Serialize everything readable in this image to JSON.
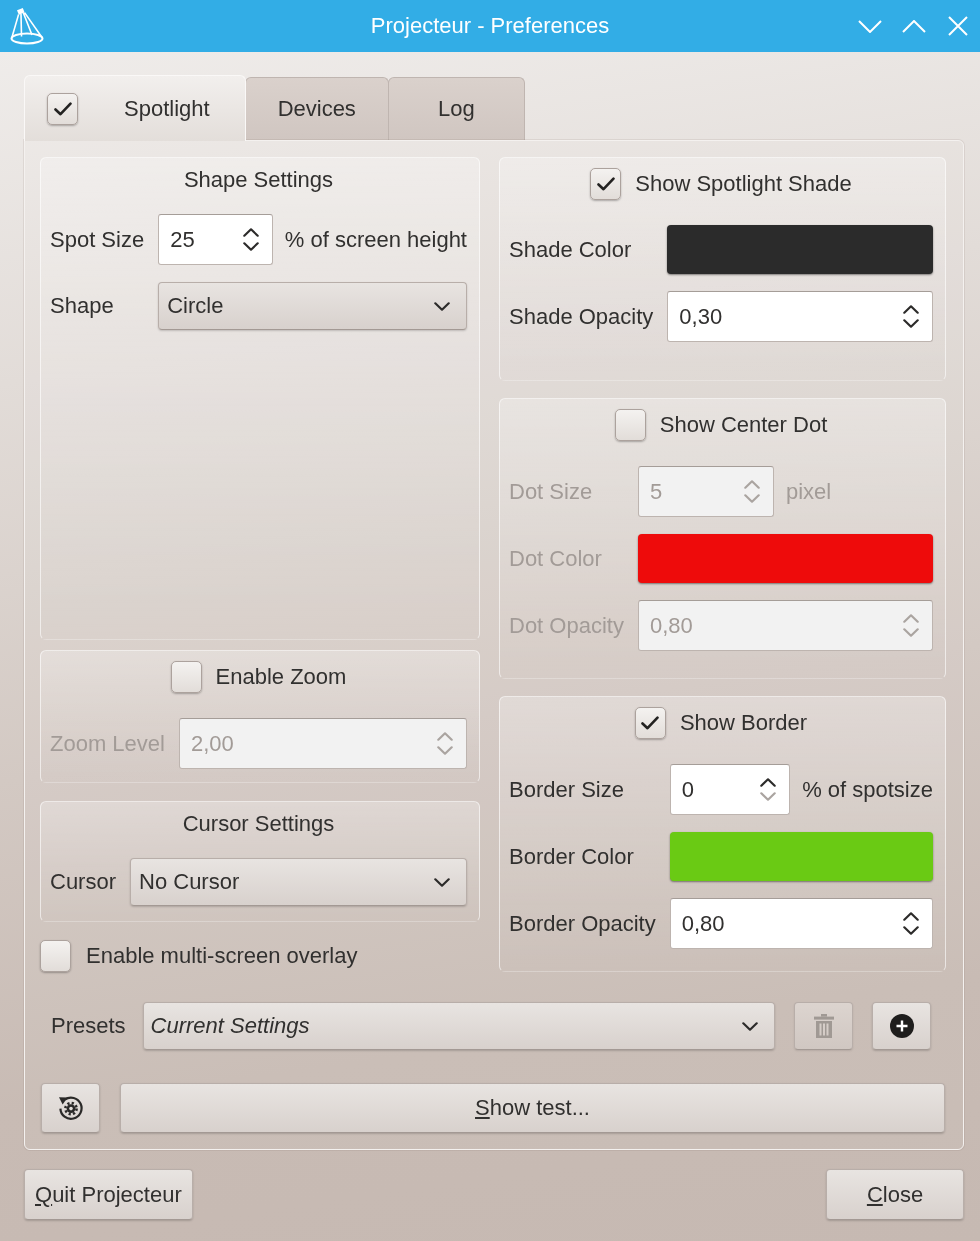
{
  "window": {
    "title": "Projecteur - Preferences"
  },
  "tabs": [
    {
      "label": "Spotlight",
      "selected": true,
      "checkbox": {
        "checked": true
      }
    },
    {
      "label": "Devices",
      "selected": false
    },
    {
      "label": "Log",
      "selected": false
    }
  ],
  "left_groups": [
    {
      "title": "Shape Settings",
      "rows": [
        {
          "kind": "spin",
          "label": "Spot Size",
          "value": "25",
          "suffix": "% of screen height"
        },
        {
          "kind": "combo",
          "label": "Shape",
          "value": "Circle"
        }
      ]
    },
    {
      "checkbox": {
        "label": "Enable Zoom",
        "checked": false
      },
      "rows": [
        {
          "kind": "spin",
          "label": "Zoom Level",
          "value": "2,00"
        }
      ]
    },
    {
      "title": "Cursor Settings",
      "rows": [
        {
          "kind": "combo",
          "label": "Cursor",
          "value": "No Cursor"
        }
      ]
    }
  ],
  "multi_screen": {
    "label": "Enable multi-screen overlay",
    "checked": false
  },
  "right_groups": [
    {
      "checkbox": {
        "label": "Show Spotlight Shade",
        "checked": true
      },
      "rows": [
        {
          "kind": "color",
          "label": "Shade Color",
          "color": "#2b2b2b"
        },
        {
          "kind": "spin",
          "label": "Shade Opacity",
          "value": "0,30"
        }
      ]
    },
    {
      "checkbox": {
        "label": "Show Center Dot",
        "checked": false
      },
      "rows": [
        {
          "kind": "spin",
          "label": "Dot Size",
          "value": "5",
          "suffix": "pixel"
        },
        {
          "kind": "color",
          "label": "Dot Color",
          "color": "#ee0b0b"
        },
        {
          "kind": "spin",
          "label": "Dot Opacity",
          "value": "0,80"
        }
      ]
    },
    {
      "checkbox": {
        "label": "Show Border",
        "checked": true
      },
      "rows": [
        {
          "kind": "spin",
          "label": "Border Size",
          "value": "0",
          "suffix": "% of spotsize",
          "at_minimum": true
        },
        {
          "kind": "color",
          "label": "Border Color",
          "color": "#6aca14"
        },
        {
          "kind": "spin",
          "label": "Border Opacity",
          "value": "0,80"
        }
      ]
    }
  ],
  "presets": {
    "label": "Presets",
    "value": "Current Settings",
    "buttons": [
      {
        "kind": "delete",
        "disabled": true
      },
      {
        "kind": "add",
        "disabled": false
      }
    ]
  },
  "test_button": {
    "label": "Show test...",
    "mnemonic": true
  },
  "footer_buttons": [
    {
      "label": "Quit Projecteur",
      "mnemonic": true
    },
    {
      "label": "Close",
      "mnemonic": true
    }
  ]
}
